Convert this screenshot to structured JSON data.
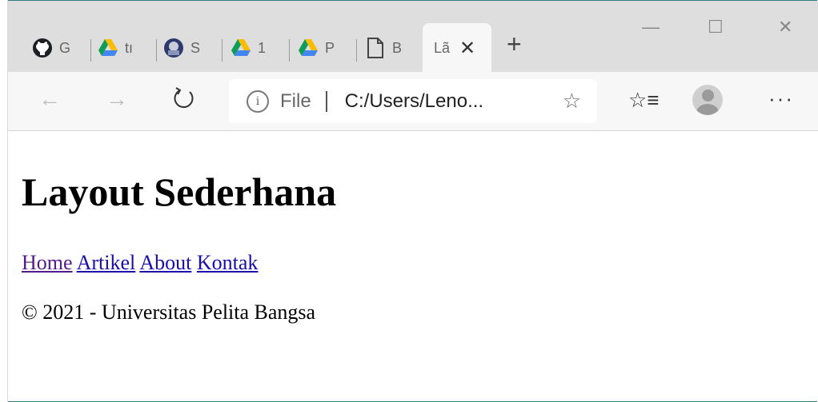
{
  "tabs": [
    {
      "label": "G",
      "icon": "github-icon"
    },
    {
      "label": "tı",
      "icon": "google-drive-icon"
    },
    {
      "label": "S",
      "icon": "university-logo-icon"
    },
    {
      "label": "1",
      "icon": "google-drive-icon"
    },
    {
      "label": "P",
      "icon": "google-drive-icon"
    },
    {
      "label": "B",
      "icon": "file-icon"
    },
    {
      "label": "Lã",
      "icon": "none",
      "active": true
    }
  ],
  "new_tab_label": "+",
  "window_controls": {
    "minimize": "—",
    "maximize": "☐",
    "close": "✕"
  },
  "address_bar": {
    "scheme": "File",
    "url": "C:/Users/Leno..."
  },
  "page": {
    "heading": "Layout Sederhana",
    "nav": [
      "Home",
      "Artikel",
      "About",
      "Kontak"
    ],
    "footer": "© 2021 - Universitas Pelita Bangsa"
  },
  "colors": {
    "link": "#1a0dab",
    "visited_link": "#551a8b",
    "tabstrip": "#dedede",
    "toolbar": "#f7f7f7"
  }
}
